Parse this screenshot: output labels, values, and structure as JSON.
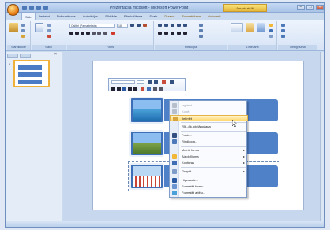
{
  "window": {
    "title": "Prezentācija micosoft - Microsoft PowerPoint",
    "context_tab_group": "SmartArt rīki"
  },
  "tabs": [
    {
      "label": "Sāk.",
      "active": true,
      "context": false
    },
    {
      "label": "Ievietot",
      "active": false,
      "context": false
    },
    {
      "label": "Noformējums",
      "active": false,
      "context": false
    },
    {
      "label": "Animācijas",
      "active": false,
      "context": false
    },
    {
      "label": "Slīdrāde",
      "active": false,
      "context": false
    },
    {
      "label": "Pārskatīšana",
      "active": false,
      "context": false
    },
    {
      "label": "Skats",
      "active": false,
      "context": false
    },
    {
      "label": "Dizains",
      "active": false,
      "context": true
    },
    {
      "label": "Formatēšana",
      "active": false,
      "context": true
    },
    {
      "label": "Noformēt",
      "active": false,
      "context": true
    }
  ],
  "ribbon": {
    "groups": [
      {
        "name": "clipboard",
        "label": "Starpliktuve"
      },
      {
        "name": "slides",
        "label": "Slaidi"
      },
      {
        "name": "font",
        "label": "Fonts"
      },
      {
        "name": "paragraph",
        "label": "Rindkopa"
      },
      {
        "name": "drawing",
        "label": "Zīmēšana"
      },
      {
        "name": "editing",
        "label": "Rediģēšana"
      }
    ],
    "font_name": "Calibri (Pamatteksts)",
    "font_size": "18"
  },
  "slides_pane": {
    "thumb_number": "1"
  },
  "context_menu": {
    "items": [
      {
        "label": "Izgriezt",
        "disabled": true,
        "submenu": false,
        "icon": "cut-icon",
        "highlight": false
      },
      {
        "label": "Kopēt",
        "disabled": true,
        "submenu": false,
        "icon": "copy-icon",
        "highlight": false
      },
      {
        "label": "Ielīmēt",
        "disabled": false,
        "submenu": false,
        "icon": "paste-icon",
        "highlight": true
      },
      {
        "label": "Rīk.-rīk. pielāgošana",
        "disabled": false,
        "submenu": false,
        "icon": "",
        "highlight": false
      },
      {
        "label": "Fonts...",
        "disabled": false,
        "submenu": false,
        "icon": "font-icon",
        "highlight": false
      },
      {
        "label": "Rindkopa...",
        "disabled": false,
        "submenu": false,
        "icon": "paragraph-icon",
        "highlight": false
      },
      {
        "label": "Mainīt formu",
        "disabled": false,
        "submenu": true,
        "icon": "",
        "highlight": false
      },
      {
        "label": "Aizpildījuma",
        "disabled": false,
        "submenu": true,
        "icon": "fill-icon",
        "highlight": false
      },
      {
        "label": "Kontūras",
        "disabled": false,
        "submenu": true,
        "icon": "outline-icon",
        "highlight": false
      },
      {
        "label": "Grupēt",
        "disabled": false,
        "submenu": true,
        "icon": "group-icon",
        "highlight": false
      },
      {
        "label": "Hipersaite...",
        "disabled": false,
        "submenu": false,
        "icon": "link-icon",
        "highlight": false
      },
      {
        "label": "Formatēt formu...",
        "disabled": false,
        "submenu": false,
        "icon": "format-icon",
        "highlight": false
      },
      {
        "label": "Formatēt attēlu...",
        "disabled": false,
        "submenu": false,
        "icon": "picture-icon",
        "highlight": false
      }
    ]
  },
  "colors": {
    "accent_blue": "#4f81c9",
    "highlight": "#ffd970",
    "office_orange": "#e77b12"
  }
}
